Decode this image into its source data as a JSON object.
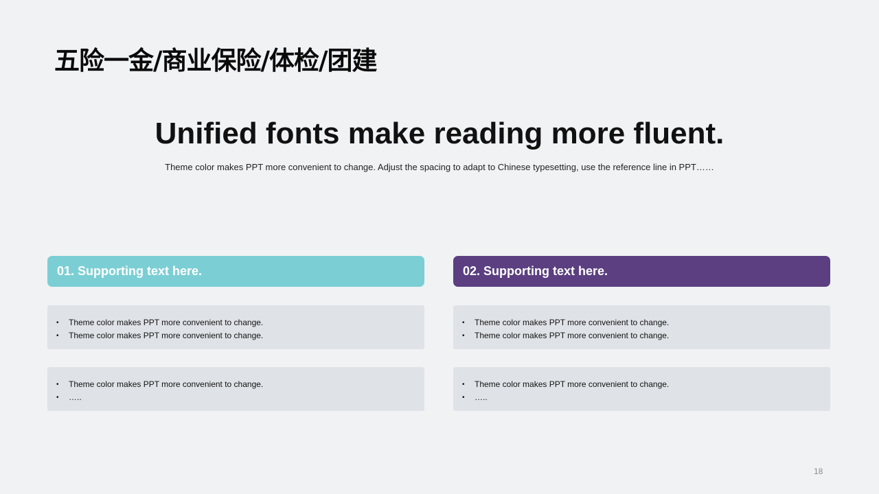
{
  "slide": {
    "title": "五险一金/商业保险/体检/团建",
    "headline": "Unified fonts make reading more fluent.",
    "subline": "Theme color makes PPT more convenient to change. Adjust the spacing to adapt to Chinese typesetting, use the reference line in PPT……",
    "page_number": "18"
  },
  "columns": [
    {
      "header": "01. Supporting text here.",
      "color": "#7bcfd4",
      "cards": [
        {
          "items": [
            "Theme color makes PPT more convenient to change.",
            "Theme color makes PPT more convenient to change."
          ]
        },
        {
          "items": [
            "Theme color makes PPT more convenient to change.",
            "….."
          ]
        }
      ]
    },
    {
      "header": "02. Supporting text here.",
      "color": "#5b3f80",
      "cards": [
        {
          "items": [
            "Theme color makes PPT more convenient to change.",
            "Theme color makes PPT more convenient to change."
          ]
        },
        {
          "items": [
            "Theme color makes PPT more convenient to change.",
            "….."
          ]
        }
      ]
    }
  ],
  "bullet_glyph": "•"
}
